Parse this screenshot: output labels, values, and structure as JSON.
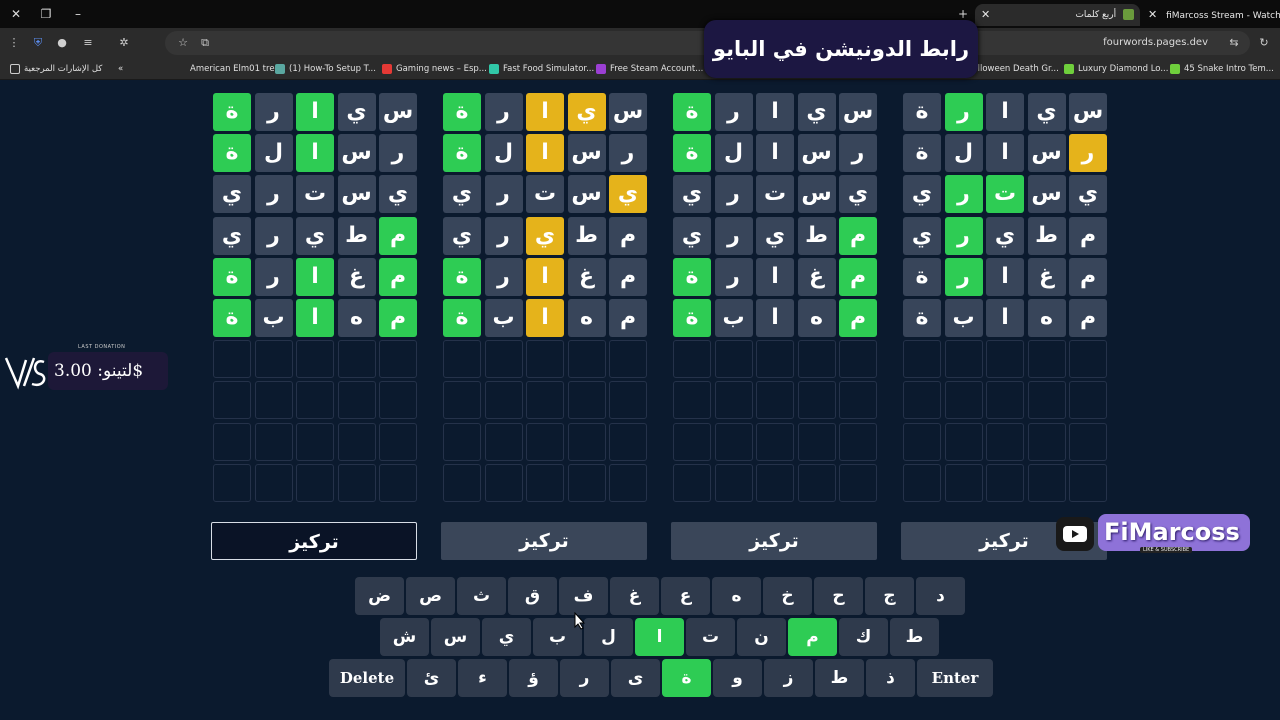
{
  "browser": {
    "tabs": [
      {
        "title": "fiMarcoss Stream - Watch Live",
        "active": false
      },
      {
        "title": "أربع كلمات",
        "active": true
      }
    ],
    "url": "fourwords.pages.dev",
    "bookmarks": [
      {
        "label": "كل الإشارات المرجعية"
      },
      {
        "label": "American Elm01 tre..."
      },
      {
        "label": "(1) How-To Setup T..."
      },
      {
        "label": "Gaming news – Esp..."
      },
      {
        "label": "Fast Food Simulator..."
      },
      {
        "label": "Free Steam Account..."
      },
      {
        "label": "Halloween Death Gr..."
      },
      {
        "label": "Luxury Diamond Lo..."
      },
      {
        "label": "45 Snake Intro Tem..."
      }
    ]
  },
  "overlay": {
    "donation_banner": "رابط الدونيشن في البايو",
    "last_donation_label": "LAST DONATION",
    "last_donation_value": "لتينو: 3.00$",
    "channel_name": "FiMarcoss",
    "channel_sub": "LIKE & SUBSCRIBE"
  },
  "colors": {
    "correct": "#2ecc54",
    "present": "#e5b31b",
    "absent": "#38455a",
    "background": "#0b1a2e"
  },
  "boards": [
    {
      "focus_label": "تركيز",
      "focused": true,
      "rows": [
        {
          "letters": [
            "س",
            "ي",
            "ا",
            "ر",
            "ة"
          ],
          "states": [
            "a",
            "a",
            "g",
            "a",
            "g"
          ]
        },
        {
          "letters": [
            "ر",
            "س",
            "ا",
            "ل",
            "ة"
          ],
          "states": [
            "a",
            "a",
            "g",
            "a",
            "g"
          ]
        },
        {
          "letters": [
            "ي",
            "س",
            "ت",
            "ر",
            "ي"
          ],
          "states": [
            "a",
            "a",
            "a",
            "a",
            "a"
          ]
        },
        {
          "letters": [
            "م",
            "ط",
            "ي",
            "ر",
            "ي"
          ],
          "states": [
            "g",
            "a",
            "a",
            "a",
            "a"
          ]
        },
        {
          "letters": [
            "م",
            "غ",
            "ا",
            "ر",
            "ة"
          ],
          "states": [
            "g",
            "a",
            "g",
            "a",
            "g"
          ]
        },
        {
          "letters": [
            "م",
            "ه",
            "ا",
            "ب",
            "ة"
          ],
          "states": [
            "g",
            "a",
            "g",
            "a",
            "g"
          ]
        }
      ]
    },
    {
      "focus_label": "تركيز",
      "focused": false,
      "rows": [
        {
          "letters": [
            "س",
            "ي",
            "ا",
            "ر",
            "ة"
          ],
          "states": [
            "a",
            "y",
            "y",
            "a",
            "g"
          ]
        },
        {
          "letters": [
            "ر",
            "س",
            "ا",
            "ل",
            "ة"
          ],
          "states": [
            "a",
            "a",
            "y",
            "a",
            "g"
          ]
        },
        {
          "letters": [
            "ي",
            "س",
            "ت",
            "ر",
            "ي"
          ],
          "states": [
            "y",
            "a",
            "a",
            "a",
            "a"
          ]
        },
        {
          "letters": [
            "م",
            "ط",
            "ي",
            "ر",
            "ي"
          ],
          "states": [
            "a",
            "a",
            "y",
            "a",
            "a"
          ]
        },
        {
          "letters": [
            "م",
            "غ",
            "ا",
            "ر",
            "ة"
          ],
          "states": [
            "a",
            "a",
            "y",
            "a",
            "g"
          ]
        },
        {
          "letters": [
            "م",
            "ه",
            "ا",
            "ب",
            "ة"
          ],
          "states": [
            "a",
            "a",
            "y",
            "a",
            "g"
          ]
        }
      ]
    },
    {
      "focus_label": "تركيز",
      "focused": false,
      "rows": [
        {
          "letters": [
            "س",
            "ي",
            "ا",
            "ر",
            "ة"
          ],
          "states": [
            "a",
            "a",
            "a",
            "a",
            "g"
          ]
        },
        {
          "letters": [
            "ر",
            "س",
            "ا",
            "ل",
            "ة"
          ],
          "states": [
            "a",
            "a",
            "a",
            "a",
            "g"
          ]
        },
        {
          "letters": [
            "ي",
            "س",
            "ت",
            "ر",
            "ي"
          ],
          "states": [
            "a",
            "a",
            "a",
            "a",
            "a"
          ]
        },
        {
          "letters": [
            "م",
            "ط",
            "ي",
            "ر",
            "ي"
          ],
          "states": [
            "g",
            "a",
            "a",
            "a",
            "a"
          ]
        },
        {
          "letters": [
            "م",
            "غ",
            "ا",
            "ر",
            "ة"
          ],
          "states": [
            "g",
            "a",
            "a",
            "a",
            "g"
          ]
        },
        {
          "letters": [
            "م",
            "ه",
            "ا",
            "ب",
            "ة"
          ],
          "states": [
            "g",
            "a",
            "a",
            "a",
            "g"
          ]
        }
      ]
    },
    {
      "focus_label": "تركيز",
      "focused": false,
      "rows": [
        {
          "letters": [
            "س",
            "ي",
            "ا",
            "ر",
            "ة"
          ],
          "states": [
            "a",
            "a",
            "a",
            "g",
            "a"
          ]
        },
        {
          "letters": [
            "ر",
            "س",
            "ا",
            "ل",
            "ة"
          ],
          "states": [
            "y",
            "a",
            "a",
            "a",
            "a"
          ]
        },
        {
          "letters": [
            "ي",
            "س",
            "ت",
            "ر",
            "ي"
          ],
          "states": [
            "a",
            "a",
            "g",
            "g",
            "a"
          ]
        },
        {
          "letters": [
            "م",
            "ط",
            "ي",
            "ر",
            "ي"
          ],
          "states": [
            "a",
            "a",
            "a",
            "g",
            "a"
          ]
        },
        {
          "letters": [
            "م",
            "غ",
            "ا",
            "ر",
            "ة"
          ],
          "states": [
            "a",
            "a",
            "a",
            "g",
            "a"
          ]
        },
        {
          "letters": [
            "م",
            "ه",
            "ا",
            "ب",
            "ة"
          ],
          "states": [
            "a",
            "a",
            "a",
            "a",
            "a"
          ]
        }
      ]
    }
  ],
  "keyboard": {
    "row1": [
      {
        "label": "د"
      },
      {
        "label": "ج"
      },
      {
        "label": "ح"
      },
      {
        "label": "خ"
      },
      {
        "label": "ه"
      },
      {
        "label": "ع"
      },
      {
        "label": "غ"
      },
      {
        "label": "ف"
      },
      {
        "label": "ق"
      },
      {
        "label": "ث"
      },
      {
        "label": "ص"
      },
      {
        "label": "ض"
      }
    ],
    "row2": [
      {
        "label": "ط"
      },
      {
        "label": "ك"
      },
      {
        "label": "م",
        "state": "g"
      },
      {
        "label": "ن"
      },
      {
        "label": "ت"
      },
      {
        "label": "ا",
        "state": "g"
      },
      {
        "label": "ل"
      },
      {
        "label": "ب"
      },
      {
        "label": "ي"
      },
      {
        "label": "س"
      },
      {
        "label": "ش"
      }
    ],
    "row3": [
      {
        "label": "Enter",
        "wide": true
      },
      {
        "label": "ذ"
      },
      {
        "label": "ط"
      },
      {
        "label": "ز"
      },
      {
        "label": "و"
      },
      {
        "label": "ة",
        "state": "g"
      },
      {
        "label": "ى"
      },
      {
        "label": "ر"
      },
      {
        "label": "ؤ"
      },
      {
        "label": "ء"
      },
      {
        "label": "ئ"
      },
      {
        "label": "Delete",
        "wide": true
      }
    ]
  }
}
